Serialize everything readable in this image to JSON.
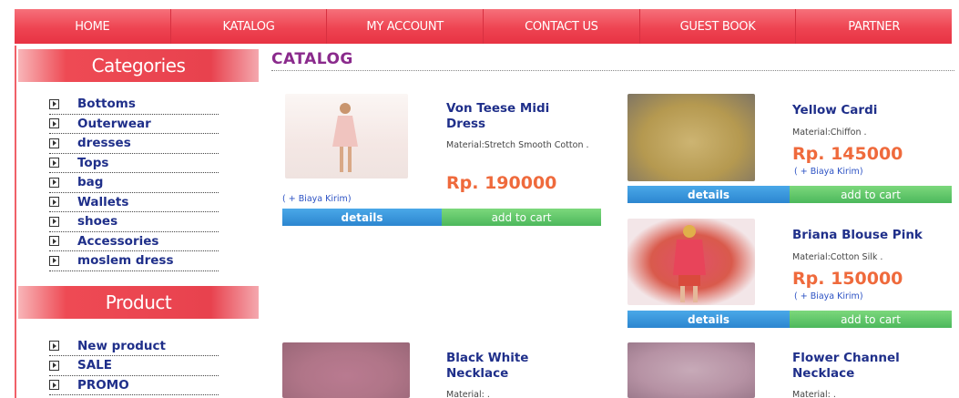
{
  "nav": {
    "items": [
      "HOME",
      "KATALOG",
      "MY ACCOUNT",
      "CONTACT US",
      "GUEST BOOK",
      "PARTNER"
    ]
  },
  "sidebar": {
    "categories_title": "Categories",
    "categories": [
      "Bottoms",
      "Outerwear",
      "dresses",
      "Tops",
      "bag",
      "Wallets",
      "shoes",
      "Accessories",
      "moslem dress"
    ],
    "product_title": "Product",
    "products": [
      "New product",
      "SALE",
      "PROMO"
    ]
  },
  "catalog": {
    "title": "CATALOG",
    "details_label": "details",
    "add_label": "add to cart",
    "ship_note": "( + Biaya Kirim)",
    "items": [
      {
        "name": "Von Teese Midi Dress",
        "material": "Material:Stretch Smooth Cotton .",
        "price": "Rp. 190000"
      },
      {
        "name": "Yellow Cardi",
        "material": "Material:Chiffon .",
        "price": "Rp. 145000"
      },
      {
        "name": "Briana Blouse Pink",
        "material": "Material:Cotton Silk .",
        "price": "Rp. 150000"
      },
      {
        "name": "Black White Necklace",
        "material": "Material: ."
      },
      {
        "name": "Flower Channel Necklace",
        "material": "Material: ."
      }
    ]
  },
  "colors": {
    "nav_red": "#f04a50",
    "link_blue": "#1f2f8a",
    "price_orange": "#ef6a3c",
    "catalog_purple": "#8a2a8c",
    "details_blue": "#2c86d0",
    "cart_green": "#4cb85c"
  }
}
